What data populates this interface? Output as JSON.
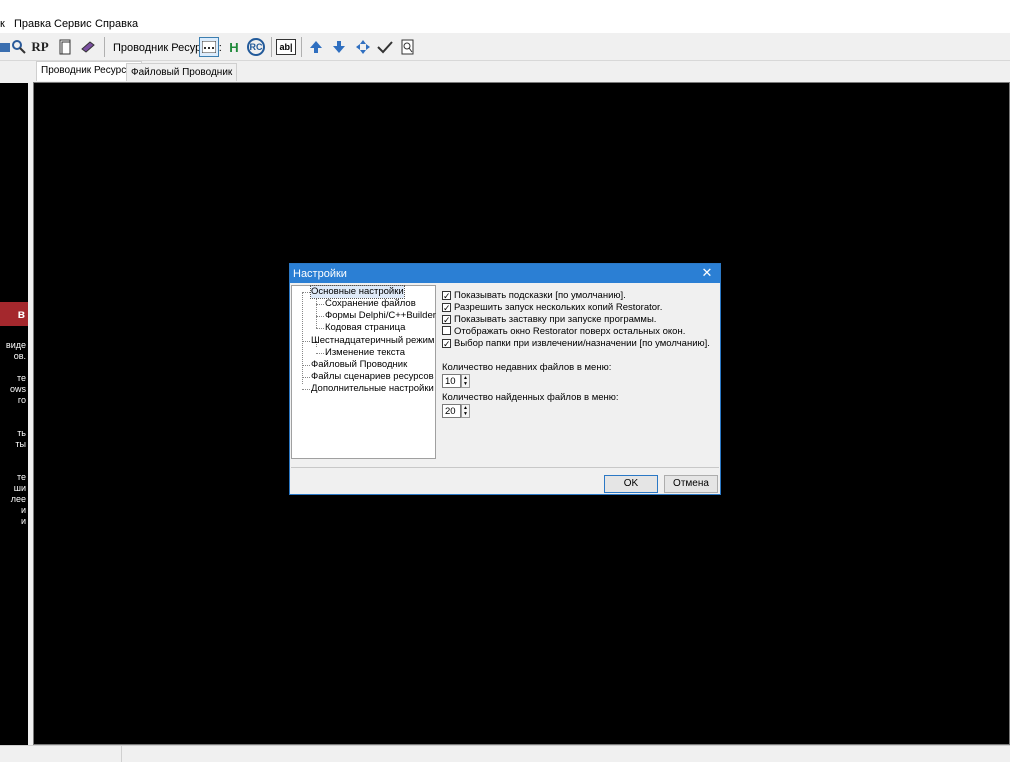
{
  "menu": {
    "file_fragment": "к",
    "edit": "Правка",
    "service": "Сервис",
    "help": "Справка"
  },
  "toolbar": {
    "resource_explorer_label": "Проводник Ресурсов:",
    "rp_label": "RP",
    "h_label": "H",
    "rc_label": "RC",
    "abl_label": "ab|"
  },
  "tabs": [
    {
      "label": "Проводник Ресурсов"
    },
    {
      "label": "Файловый Проводник"
    }
  ],
  "left_panel": {
    "red_fragment": "в",
    "fragments": [
      "виде",
      "ов.",
      "те",
      "ows",
      "го",
      "ть",
      "ты",
      "те",
      "ши",
      "лее",
      "и",
      "и"
    ]
  },
  "dialog": {
    "title": "Настройки",
    "tree": [
      "Основные настройки",
      "Сохранение файлов",
      "Формы Delphi/C++Builder",
      "Кодовая страница",
      "Шестнадцатеричный режим",
      "Изменение текста",
      "Файловый Проводник",
      "Файлы сценариев ресурсов",
      "Дополнительные настройки"
    ],
    "options": [
      {
        "label": "Показывать подсказки [по умолчанию].",
        "checked": true
      },
      {
        "label": "Разрешить запуск нескольких копий Restorator.",
        "checked": true
      },
      {
        "label": "Показывать заставку при запуске программы.",
        "checked": true
      },
      {
        "label": "Отображать окно Restorator поверх остальных окон.",
        "checked": false
      },
      {
        "label": "Выбор папки при извлечении/назначении [по умолчанию].",
        "checked": true
      }
    ],
    "recent_files_label": "Количество недавних файлов в меню:",
    "recent_files_value": "10",
    "found_files_label": "Количество найденных файлов в меню:",
    "found_files_value": "20",
    "ok_label": "OK",
    "cancel_label": "Отмена"
  }
}
